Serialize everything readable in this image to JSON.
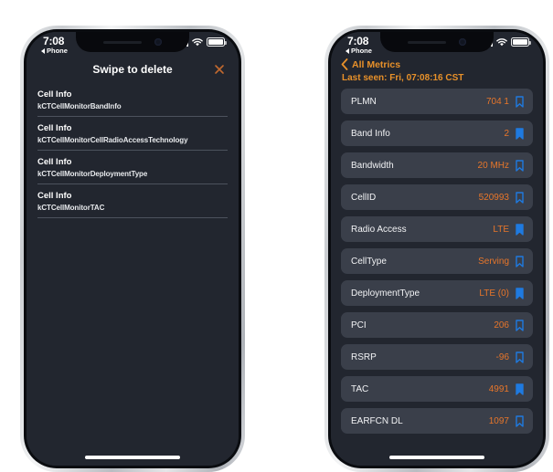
{
  "colors": {
    "screen_bg": "#22262f",
    "row_bg": "#3a3f4a",
    "accent_orange": "#e8912a",
    "value_orange": "#e8762a",
    "bookmark_blue": "#1f7ae0",
    "close_x": "#c2692f"
  },
  "left_phone": {
    "status_bar": {
      "time": "7:08",
      "back_label": "Phone",
      "signal_icon": "signal-bars-icon",
      "wifi_icon": "wifi-icon",
      "battery_icon": "battery-icon"
    },
    "header": {
      "title": "Swipe to delete",
      "close_icon": "close-x-icon"
    },
    "list": [
      {
        "title": "Cell Info",
        "subtitle": "kCTCellMonitorBandInfo"
      },
      {
        "title": "Cell Info",
        "subtitle": "kCTCellMonitorCellRadioAccessTechnology"
      },
      {
        "title": "Cell Info",
        "subtitle": "kCTCellMonitorDeploymentType"
      },
      {
        "title": "Cell Info",
        "subtitle": "kCTCellMonitorTAC"
      }
    ]
  },
  "right_phone": {
    "status_bar": {
      "time": "7:08",
      "back_label": "Phone",
      "signal_icon": "signal-bars-icon",
      "wifi_icon": "wifi-icon",
      "battery_icon": "battery-icon"
    },
    "nav": {
      "back_icon": "chevron-left-icon",
      "back_label": "All Metrics"
    },
    "last_seen": "Last seen: Fri, 07:08:16 CST",
    "metrics": [
      {
        "label": "PLMN",
        "value": "704 1",
        "bookmark": "outline"
      },
      {
        "label": "Band Info",
        "value": "2",
        "bookmark": "filled"
      },
      {
        "label": "Bandwidth",
        "value": "20 MHz",
        "bookmark": "outline"
      },
      {
        "label": "CellID",
        "value": "520993",
        "bookmark": "outline"
      },
      {
        "label": "Radio Access",
        "value": "LTE",
        "bookmark": "filled"
      },
      {
        "label": "CellType",
        "value": "Serving",
        "bookmark": "outline"
      },
      {
        "label": "DeploymentType",
        "value": "LTE (0)",
        "bookmark": "filled"
      },
      {
        "label": "PCI",
        "value": "206",
        "bookmark": "outline"
      },
      {
        "label": "RSRP",
        "value": "-96",
        "bookmark": "outline"
      },
      {
        "label": "TAC",
        "value": "4991",
        "bookmark": "filled"
      },
      {
        "label": "EARFCN DL",
        "value": "1097",
        "bookmark": "outline"
      }
    ]
  }
}
